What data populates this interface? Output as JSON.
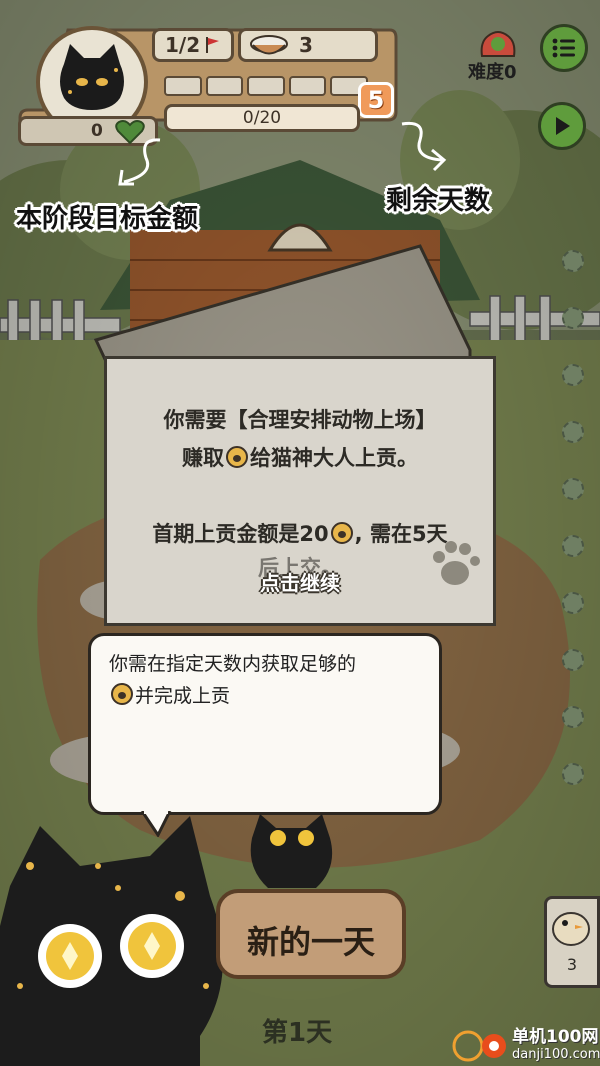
{
  "hud": {
    "level_progress": "1/2",
    "bowl_count": "3",
    "coin_count": "0",
    "goal_progress": "0/20",
    "days_remaining": "5",
    "difficulty": "难度0"
  },
  "annotations": {
    "target_amount": "本阶段目标金额",
    "remaining_days": "剩余天数"
  },
  "dialog": {
    "line1": "你需要【合理安排动物上场】",
    "line2_before": "赚取",
    "line2_after": "给猫神大人上贡。",
    "line3_before": "首期上贡金额是20",
    "line3_after": ", 需在5天",
    "line4": "后上交。",
    "continue": "点击继续"
  },
  "bubble": {
    "line1": "你需在指定天数内获取足够的",
    "line2": "并完成上贡"
  },
  "bottom": {
    "new_day": "新的一天",
    "day_label": "第1天",
    "side_card_count": "3"
  },
  "watermark": {
    "site_cn": "单机100网",
    "site_url": "danji100.com"
  },
  "colors": {
    "accent_green": "#5f9c3c",
    "badge_orange": "#f09a5a",
    "paw_gold": "#e8b64a"
  },
  "icons": [
    "cat-avatar-icon",
    "flag-icon",
    "bowl-icon",
    "heart-icon",
    "menu-icon",
    "play-icon",
    "paw-coin-icon",
    "difficulty-icon"
  ]
}
